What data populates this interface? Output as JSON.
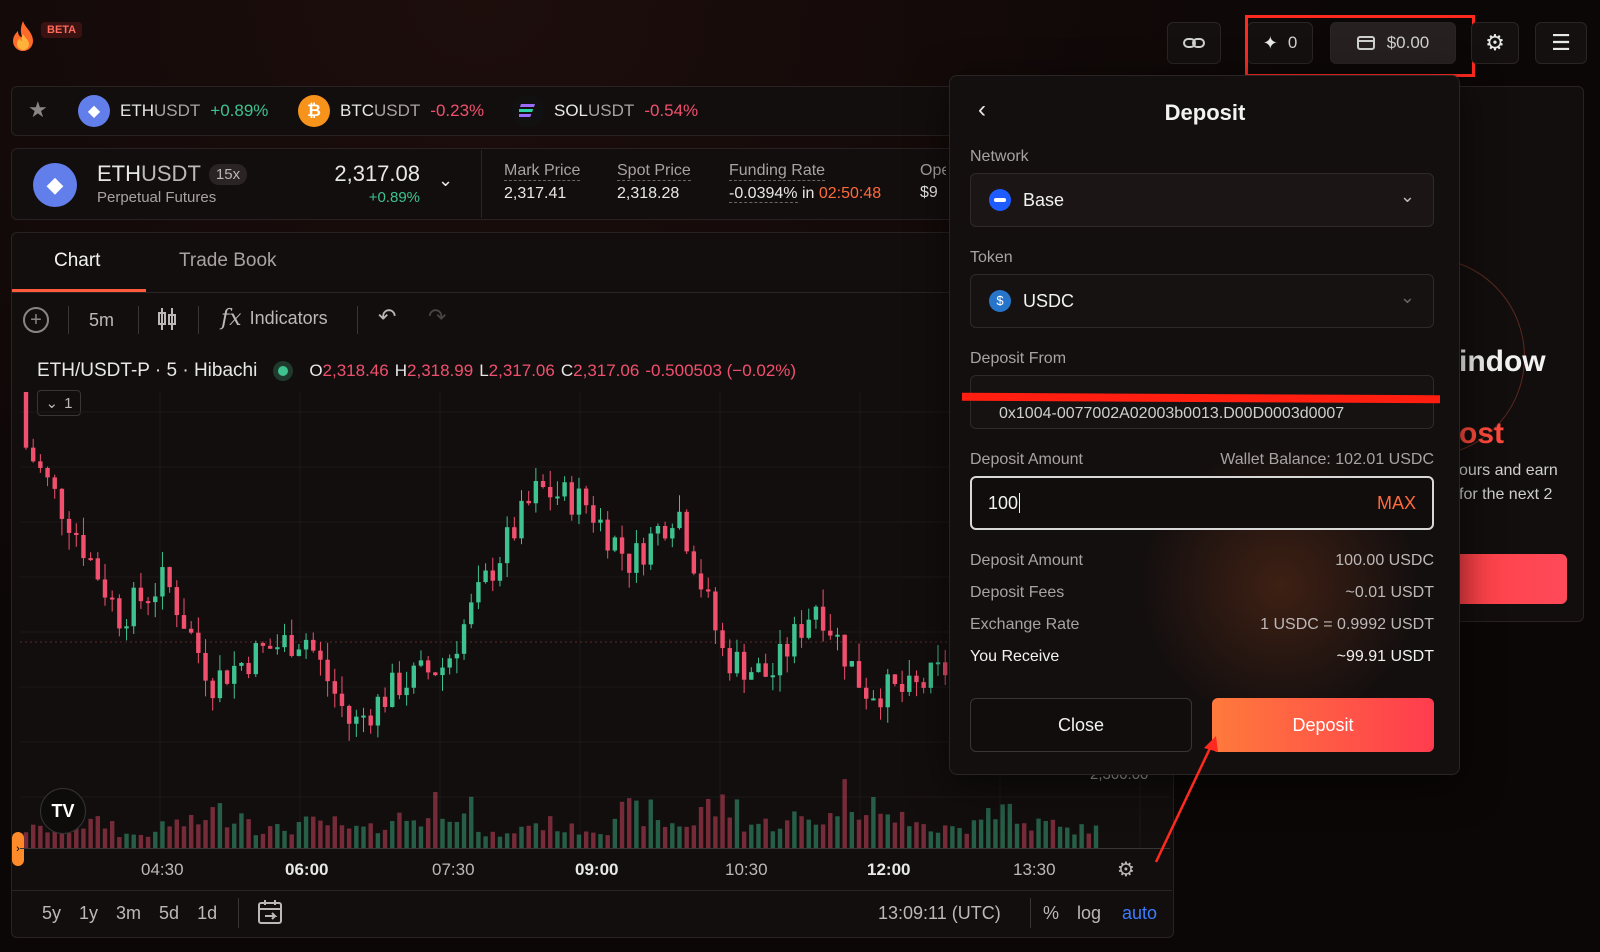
{
  "header": {
    "badge": "BETA",
    "points": "0",
    "balance": "$0.00"
  },
  "ticker": [
    {
      "base": "ETH",
      "quote": "USDT",
      "change": "+0.89%",
      "dir": "pos"
    },
    {
      "base": "BTC",
      "quote": "USDT",
      "change": "-0.23%",
      "dir": "neg"
    },
    {
      "base": "SOL",
      "quote": "USDT",
      "change": "-0.54%",
      "dir": "neg"
    }
  ],
  "market": {
    "base": "ETH",
    "quote": "USDT",
    "leverage": "15x",
    "type": "Perpetual Futures",
    "price": "2,317.08",
    "change": "+0.89%",
    "mark_label": "Mark Price",
    "mark": "2,317.41",
    "spot_label": "Spot Price",
    "spot": "2,318.28",
    "funding_label": "Funding Rate",
    "funding": "-0.0394%",
    "funding_in": "in",
    "funding_time": "02:50:48",
    "open_label": "Ope",
    "open_value": "$9"
  },
  "tabs": {
    "chart": "Chart",
    "book": "Trade Book"
  },
  "toolbar": {
    "interval": "5m",
    "indicators": "Indicators"
  },
  "legend": {
    "symbol": "ETH/USDT-P · 5 · Hibachi",
    "o_label": "O",
    "o": "2,318.46",
    "h_label": "H",
    "h": "2,318.99",
    "l_label": "L",
    "l": "2,317.06",
    "c_label": "C",
    "c": "2,317.06",
    "chg": "-0.500503 (−0.02%)",
    "collapse": "1"
  },
  "price_axis": {
    "label": "2,300.00"
  },
  "time_axis": [
    {
      "t": "04:30",
      "bold": false
    },
    {
      "t": "06:00",
      "bold": true
    },
    {
      "t": "07:30",
      "bold": false
    },
    {
      "t": "09:00",
      "bold": true
    },
    {
      "t": "10:30",
      "bold": false
    },
    {
      "t": "12:00",
      "bold": true
    },
    {
      "t": "13:30",
      "bold": false
    }
  ],
  "bottom": {
    "ranges": [
      "5y",
      "1y",
      "3m",
      "5d",
      "1d"
    ],
    "time": "13:09:11 (UTC)",
    "pct": "%",
    "log": "log",
    "auto": "auto"
  },
  "promo": {
    "line1": "indow",
    "line2": "ost",
    "line3": "ours and earn",
    "line4": "for the next 2"
  },
  "deposit": {
    "title": "Deposit",
    "network_label": "Network",
    "network": "Base",
    "token_label": "Token",
    "token": "USDC",
    "from_label": "Deposit From",
    "from_value": "0x1004-0077002A02003b0013.D00D0003d0007",
    "amount_label": "Deposit Amount",
    "wallet_balance": "Wallet Balance: 102.01 USDC",
    "amount_value": "100",
    "max": "MAX",
    "summary": [
      {
        "k": "Deposit Amount",
        "v": "100.00 USDC"
      },
      {
        "k": "Deposit Fees",
        "v": "~0.01 USDT"
      },
      {
        "k": "Exchange Rate",
        "v": "1 USDC = 0.9992 USDT"
      },
      {
        "k": "You Receive",
        "v": "~99.91 USDT"
      }
    ],
    "close": "Close",
    "submit": "Deposit"
  },
  "colors": {
    "up": "#3ec28f",
    "down": "#f0506e",
    "accent": "#ff5a3c",
    "highlight": "#ff2a1f"
  },
  "chart_data": {
    "type": "candlestick",
    "symbol": "ETH/USDT-P",
    "interval": "5m",
    "x": [
      "03:30",
      "03:55",
      "04:20",
      "04:45",
      "05:10",
      "05:35",
      "06:00",
      "06:25",
      "06:50",
      "07:15",
      "07:40",
      "08:05",
      "08:30",
      "08:55",
      "09:20",
      "09:45",
      "10:10",
      "10:35",
      "11:00",
      "11:25",
      "11:50",
      "12:15",
      "12:40",
      "13:05"
    ],
    "close": [
      2318.9,
      2313.6,
      2307.4,
      2309.8,
      2302.9,
      2304.9,
      2306.0,
      2299.8,
      2302.7,
      2304.0,
      2310.5,
      2316.0,
      2315.2,
      2311.0,
      2314.9,
      2304.6,
      2303.2,
      2308.4,
      2302.4,
      2302.1,
      2304.2,
      2312.0,
      2311.9,
      2316.6
    ],
    "volume": [
      2,
      3,
      1,
      3,
      5,
      2,
      3,
      2,
      4,
      7,
      1,
      3,
      2,
      5,
      3,
      6,
      3,
      4,
      8,
      4,
      2,
      6,
      3,
      2
    ],
    "price_label": "2,300.00"
  }
}
